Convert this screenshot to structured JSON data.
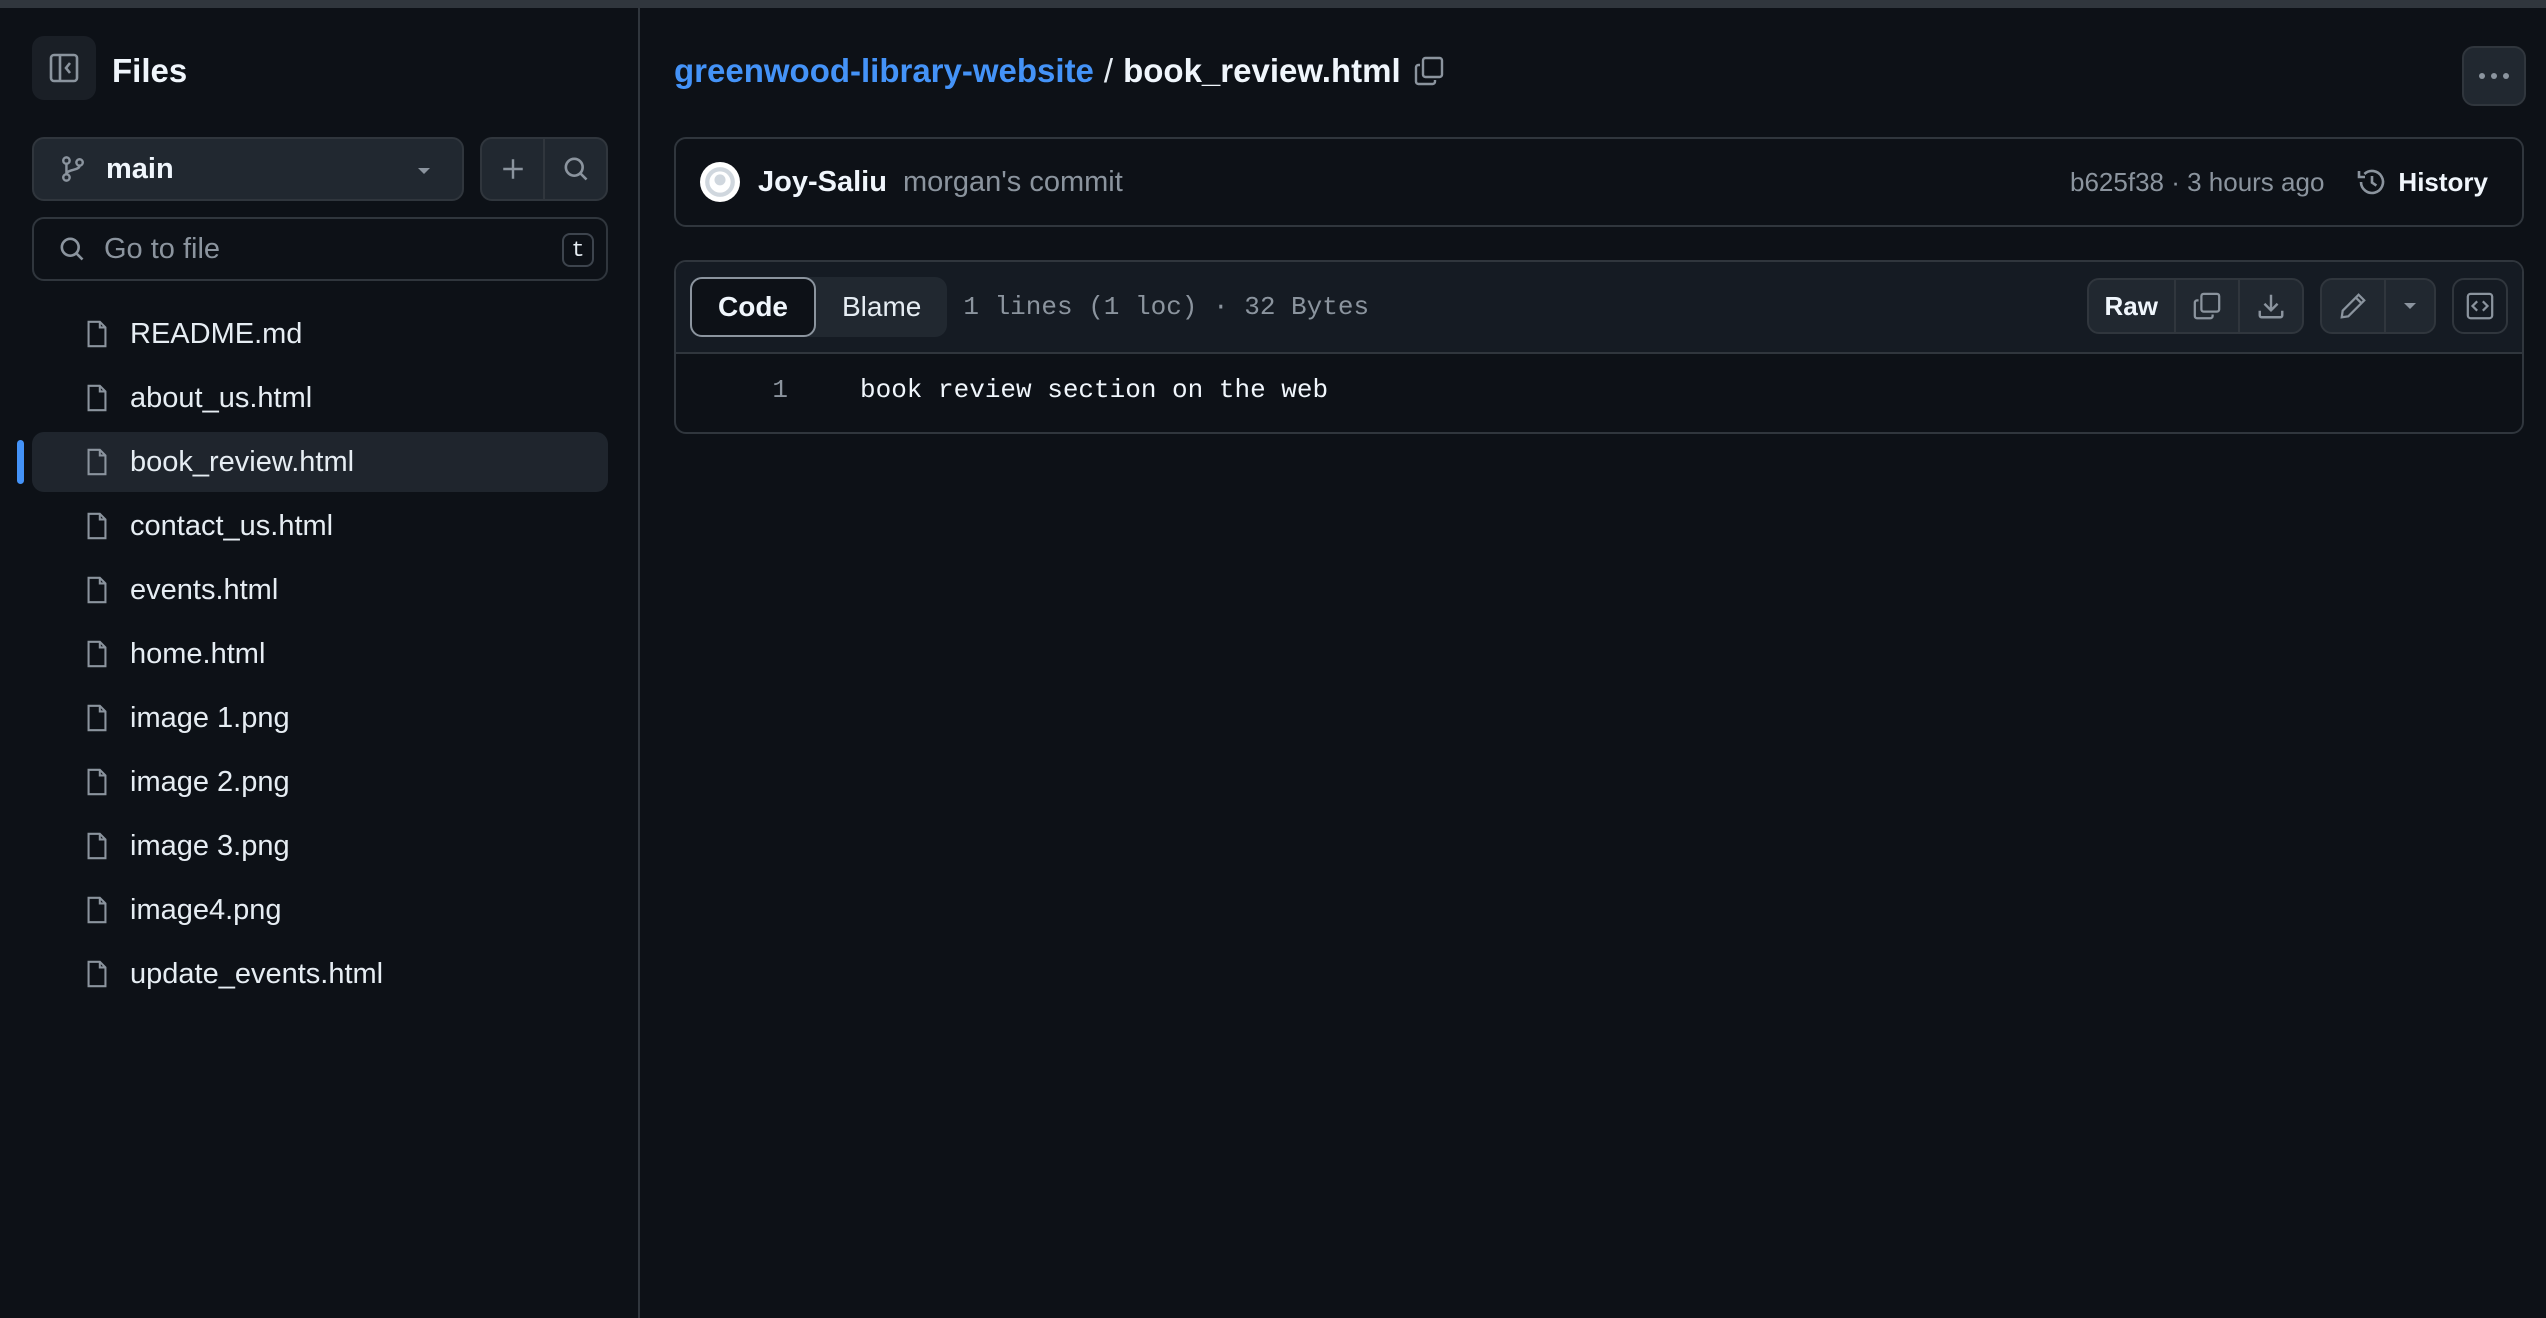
{
  "sidebar": {
    "title": "Files",
    "branch": "main",
    "search_placeholder": "Go to file",
    "shortcut_key": "t",
    "files": [
      {
        "label": "README.md"
      },
      {
        "label": "about_us.html"
      },
      {
        "label": "book_review.html",
        "active": true
      },
      {
        "label": "contact_us.html"
      },
      {
        "label": "events.html"
      },
      {
        "label": "home.html"
      },
      {
        "label": "image 1.png"
      },
      {
        "label": "image 2.png"
      },
      {
        "label": "image 3.png"
      },
      {
        "label": "image4.png"
      },
      {
        "label": "update_events.html"
      }
    ]
  },
  "breadcrumb": {
    "repo": "greenwood-library-website",
    "separator": "/",
    "file": "book_review.html"
  },
  "commit": {
    "author": "Joy-Saliu",
    "message": "morgan's commit",
    "sha_time": "b625f38 · 3 hours ago",
    "history_label": "History"
  },
  "file_view": {
    "tab_code": "Code",
    "tab_blame": "Blame",
    "meta": "1 lines (1 loc) · 32 Bytes",
    "raw_label": "Raw",
    "lines": [
      {
        "num": "1",
        "text": "book review section on the web"
      }
    ]
  },
  "colors": {
    "background": "#0d1117",
    "accent": "#4493f8",
    "border": "#30363d"
  }
}
